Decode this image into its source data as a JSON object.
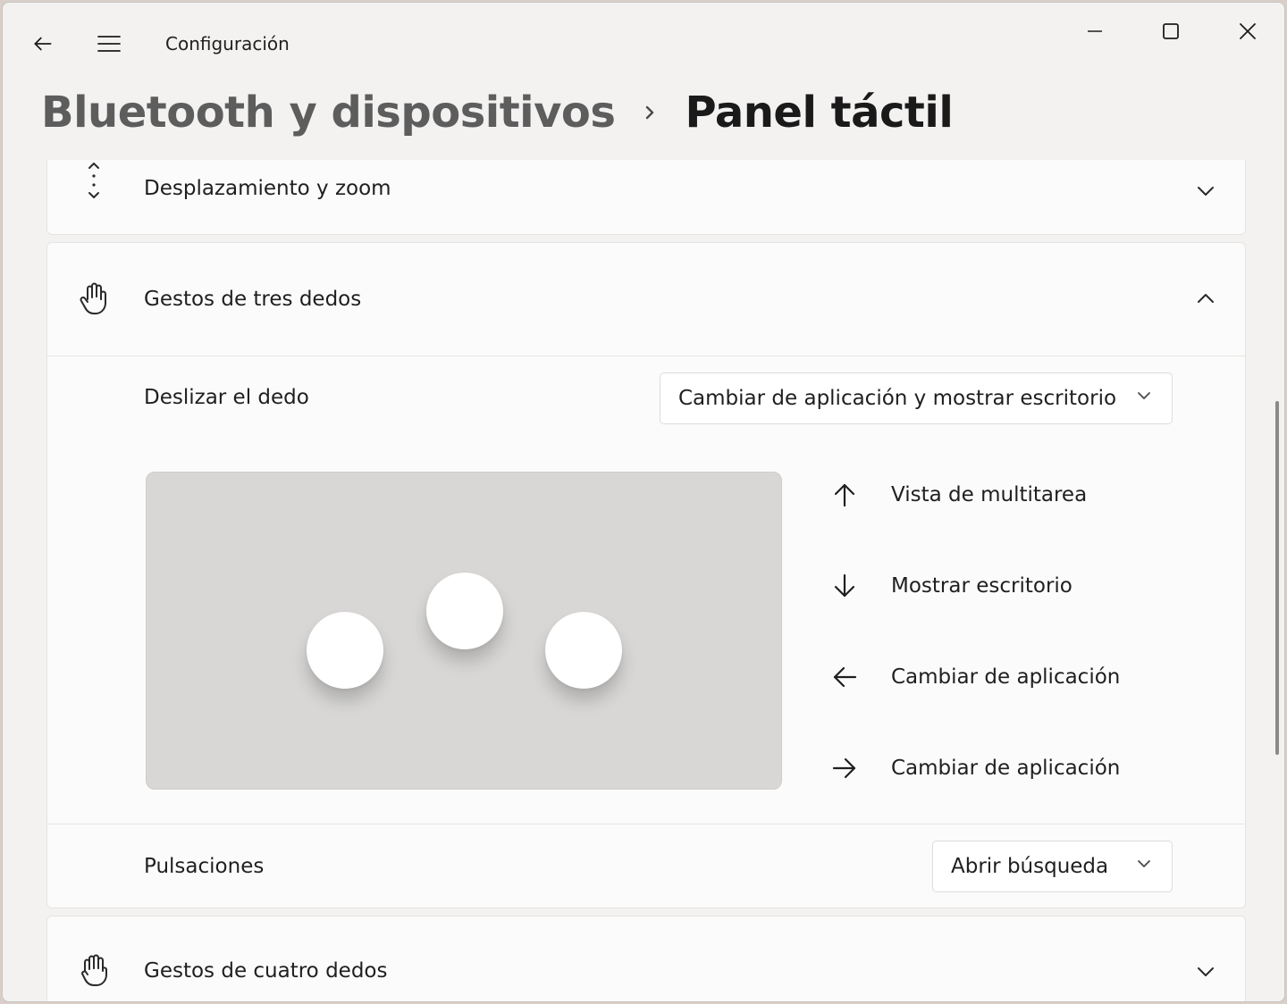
{
  "app": {
    "title": "Configuración"
  },
  "breadcrumb": {
    "parent": "Bluetooth y dispositivos",
    "current": "Panel táctil"
  },
  "sections": {
    "scroll_zoom": {
      "label": "Desplazamiento y zoom",
      "icon": "scroll-icon",
      "expanded": false
    },
    "three_finger": {
      "label": "Gestos de tres dedos",
      "icon": "hand-icon",
      "expanded": true,
      "swipe": {
        "label": "Deslizar el dedo",
        "value": "Cambiar de aplicación y mostrar escritorio"
      },
      "gestures": [
        {
          "icon": "arrow-up-icon",
          "label": "Vista de multitarea"
        },
        {
          "icon": "arrow-down-icon",
          "label": "Mostrar escritorio"
        },
        {
          "icon": "arrow-left-icon",
          "label": "Cambiar de aplicación"
        },
        {
          "icon": "arrow-right-icon",
          "label": "Cambiar de aplicación"
        }
      ],
      "taps": {
        "label": "Pulsaciones",
        "value": "Abrir búsqueda"
      }
    },
    "four_finger": {
      "label": "Gestos de cuatro dedos",
      "icon": "hand-icon",
      "expanded": false
    }
  }
}
